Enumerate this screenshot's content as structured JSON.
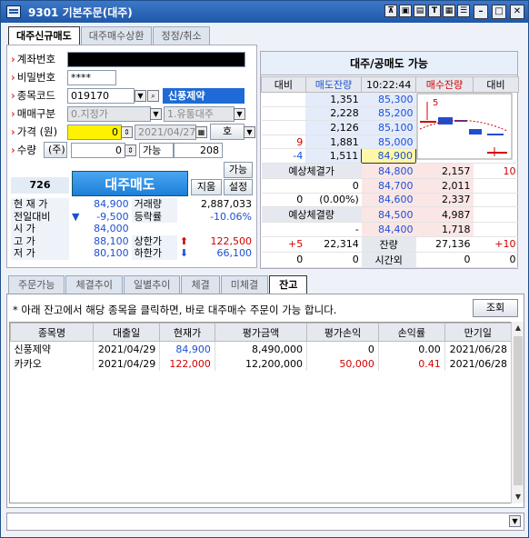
{
  "window": {
    "title": "9301 기본주문(대주)",
    "toolbar_icons": [
      "pin-icon",
      "screen-icon",
      "doc-icon",
      "text-icon",
      "table-icon",
      "menu-icon"
    ]
  },
  "top_tabs": [
    "대주신규매도",
    "대주매수상환",
    "정정/취소"
  ],
  "form": {
    "account_label": "계좌번호",
    "password_label": "비밀번호",
    "password_value": "****",
    "code_label": "종목코드",
    "code_value": "019170",
    "stock_name": "신풍제약",
    "trade_type_label": "매매구분",
    "trade_type_value": "0.지정가",
    "sub_type_value": "1.유통대주",
    "price_label": "가격 (원)",
    "price_value": "0",
    "date_value": "2021/04/27",
    "ho_label": "호",
    "qty_label": "수량",
    "qty_unit": "(주)",
    "qty_value": "0",
    "avail_label": "가능",
    "avail_value": "208",
    "code_badge": "726",
    "sell_button": "대주매도",
    "btn_avail": "가능",
    "btn_clear": "지움",
    "btn_settings": "설정"
  },
  "info": {
    "rows": [
      {
        "l1": "현 재 가",
        "v1": "84,900",
        "l2": "거래량",
        "v2": "2,887,033"
      },
      {
        "l1": "전일대비",
        "v1": "-9,500",
        "l2": "등락률",
        "v2": "-10.06%"
      },
      {
        "l1": "시    가",
        "v1": "84,000",
        "l2": "",
        "v2": ""
      },
      {
        "l1": "고    가",
        "v1": "88,100",
        "l2": "상한가",
        "v2": "122,500"
      },
      {
        "l1": "저    가",
        "v1": "80,100",
        "l2": "하한가",
        "v2": "66,100"
      }
    ]
  },
  "orderbook": {
    "title": "대주/공매도 가능",
    "headers": [
      "대비",
      "매도잔량",
      "10:22:44",
      "매수잔량",
      "대비"
    ],
    "asks": [
      {
        "diff": "",
        "qty": "1,351",
        "price": "85,300"
      },
      {
        "diff": "",
        "qty": "2,228",
        "price": "85,200"
      },
      {
        "diff": "",
        "qty": "2,126",
        "price": "85,100"
      },
      {
        "diff": "9",
        "qty": "1,881",
        "price": "85,000"
      },
      {
        "diff": "-4",
        "qty": "1,511",
        "price": "84,900"
      }
    ],
    "mid": [
      {
        "left": "예상체결가",
        "val": "",
        "price": "84,800",
        "bqty": "2,157",
        "bdiff": "10"
      },
      {
        "left": "",
        "val": "0",
        "price": "84,700",
        "bqty": "2,011",
        "bdiff": ""
      },
      {
        "left": "0",
        "val": "(0.00%)",
        "price": "84,600",
        "bqty": "2,337",
        "bdiff": ""
      },
      {
        "left": "예상체결량",
        "val": "",
        "price": "84,500",
        "bqty": "4,987",
        "bdiff": ""
      },
      {
        "left": "",
        "val": "-",
        "price": "84,400",
        "bqty": "1,718",
        "bdiff": ""
      }
    ],
    "totals": {
      "ask_diff": "+5",
      "ask_total": "22,314",
      "label": "잔량",
      "bid_total": "27,136",
      "bid_diff": "+10"
    },
    "after": {
      "a": "0",
      "b": "0",
      "label": "시간외",
      "c": "0",
      "d": "0"
    },
    "chart_label": "5"
  },
  "mid_tabs": [
    "주문가능",
    "체결추이",
    "일별추이",
    "체결",
    "미체결",
    "잔고"
  ],
  "balance": {
    "notice": "* 아래 잔고에서 해당 종목을 클릭하면, 바로 대주매수 주문이 가능 합니다.",
    "lookup_button": "조회",
    "columns": [
      "종목명",
      "대출일",
      "현재가",
      "평가금액",
      "평가손익",
      "손익률",
      "만기일"
    ],
    "rows": [
      [
        "신풍제약",
        "2021/04/29",
        "84,900",
        "8,490,000",
        "0",
        "0.00",
        "2021/06/28"
      ],
      [
        "카카오",
        "2021/04/29",
        "122,000",
        "12,200,000",
        "50,000",
        "0.41",
        "2021/06/28"
      ]
    ]
  },
  "colors": {
    "accent": "#1f6ad6",
    "up": "#d10000",
    "down": "#1d4fd4",
    "highlight": "#fff200"
  }
}
